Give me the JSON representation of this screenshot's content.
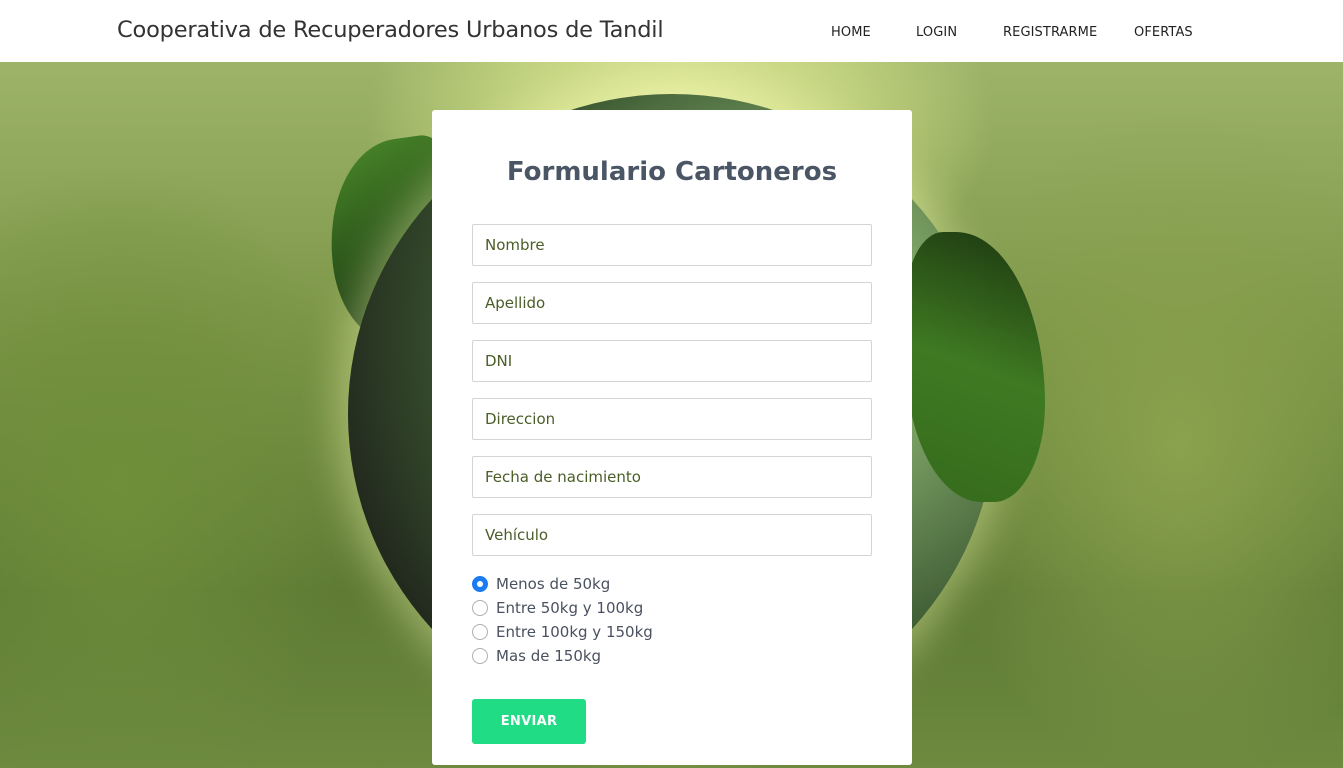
{
  "header": {
    "brand": "Cooperativa de Recuperadores Urbanos de Tandil",
    "nav": [
      {
        "label": "HOME"
      },
      {
        "label": "LOGIN"
      },
      {
        "label": "REGISTRARME"
      },
      {
        "label": "OFERTAS"
      }
    ]
  },
  "form": {
    "title": "Formulario Cartoneros",
    "fields": [
      {
        "placeholder": "Nombre",
        "value": ""
      },
      {
        "placeholder": "Apellido",
        "value": ""
      },
      {
        "placeholder": "DNI",
        "value": ""
      },
      {
        "placeholder": "Direccion",
        "value": ""
      },
      {
        "placeholder": "Fecha de nacimiento",
        "value": ""
      },
      {
        "placeholder": "Vehículo",
        "value": ""
      }
    ],
    "weight_options": [
      {
        "label": "Menos de 50kg",
        "checked": true
      },
      {
        "label": "Entre 50kg y 100kg",
        "checked": false
      },
      {
        "label": "Entre 100kg y 150kg",
        "checked": false
      },
      {
        "label": "Mas de 150kg",
        "checked": false
      }
    ],
    "submit_label": "ENVIAR"
  },
  "colors": {
    "accent": "#1fdc85",
    "radio_checked": "#1a7cf0",
    "title": "#4a5565"
  }
}
